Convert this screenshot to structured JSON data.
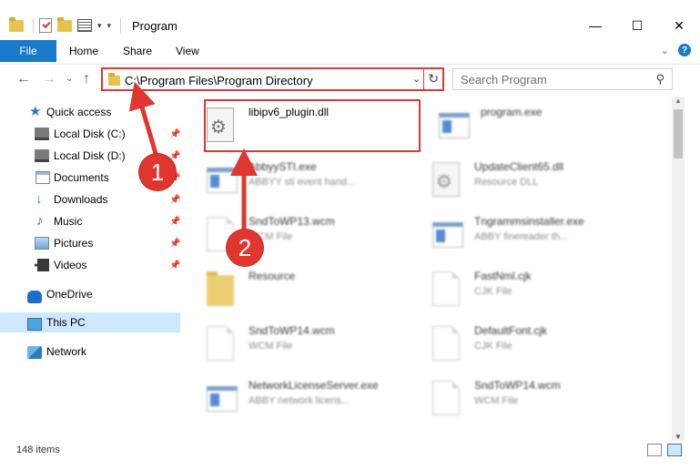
{
  "window": {
    "title": "Program",
    "minimize_glyph": "—",
    "maximize_glyph": "☐",
    "close_glyph": "✕"
  },
  "ribbon": {
    "tabs": [
      "File",
      "Home",
      "Share",
      "View"
    ],
    "help_glyph": "?"
  },
  "navigation": {
    "back_glyph": "←",
    "forward_glyph": "→",
    "recent_glyph": "⌄",
    "up_glyph": "↑"
  },
  "address": {
    "path": "C:\\Program Files\\Program Directory",
    "dropdown_glyph": "⌄",
    "refresh_glyph": "↻"
  },
  "search": {
    "placeholder": "Search Program",
    "icon": "search-icon"
  },
  "sidebar": {
    "items": [
      {
        "label": "Quick access",
        "icon": "star-icon"
      },
      {
        "label": "Local Disk (C:)",
        "icon": "drive-icon",
        "pinned": true
      },
      {
        "label": "Local Disk (D:)",
        "icon": "drive-icon",
        "pinned": true
      },
      {
        "label": "Documents",
        "icon": "documents-icon",
        "pinned": true
      },
      {
        "label": "Downloads",
        "icon": "downloads-icon",
        "pinned": true
      },
      {
        "label": "Music",
        "icon": "music-icon",
        "pinned": true
      },
      {
        "label": "Pictures",
        "icon": "pictures-icon",
        "pinned": true
      },
      {
        "label": "Videos",
        "icon": "videos-icon",
        "pinned": true
      },
      {
        "label": "OneDrive",
        "icon": "cloud-icon"
      },
      {
        "label": "This PC",
        "icon": "pc-icon",
        "selected": true
      },
      {
        "label": "Network",
        "icon": "network-icon"
      }
    ],
    "pin_glyph": "📌"
  },
  "files": [
    {
      "name": "libipv6_plugin.dll",
      "type": "",
      "icon": "dll-icon"
    },
    {
      "name": "program.exe",
      "type": "",
      "icon": "app-icon"
    },
    {
      "name": "AbbyySTI.exe",
      "type": "ABBYY sti event hand...",
      "icon": "app-icon"
    },
    {
      "name": "UpdateClient65.dll",
      "type": "Resource DLL",
      "icon": "dll-icon"
    },
    {
      "name": "SndToWP13.wcm",
      "type": "WCM File",
      "icon": "doc-icon"
    },
    {
      "name": "Tngrammsinstaller.exe",
      "type": "ABBY finereader th...",
      "icon": "app-icon"
    },
    {
      "name": "Resource",
      "type": "",
      "icon": "folder-icon"
    },
    {
      "name": "FastNml.cjk",
      "type": "CJK File",
      "icon": "doc-icon"
    },
    {
      "name": "SndToWP14.wcm",
      "type": "WCM File",
      "icon": "doc-icon"
    },
    {
      "name": "DefaultFont.cjk",
      "type": "CJK File",
      "icon": "doc-icon"
    },
    {
      "name": "NetworkLicenseServer.exe",
      "type": "ABBY network licens...",
      "icon": "app-icon"
    },
    {
      "name": "SndToWP14.wcm",
      "type": "WCM File",
      "icon": "doc-icon"
    }
  ],
  "status": {
    "item_count": "148 items"
  },
  "annotations": {
    "step1": "1",
    "step2": "2",
    "color": "#e0362f"
  },
  "colors": {
    "accent": "#1979ca",
    "selection": "#cde8ff",
    "highlight": "#e0362f"
  }
}
